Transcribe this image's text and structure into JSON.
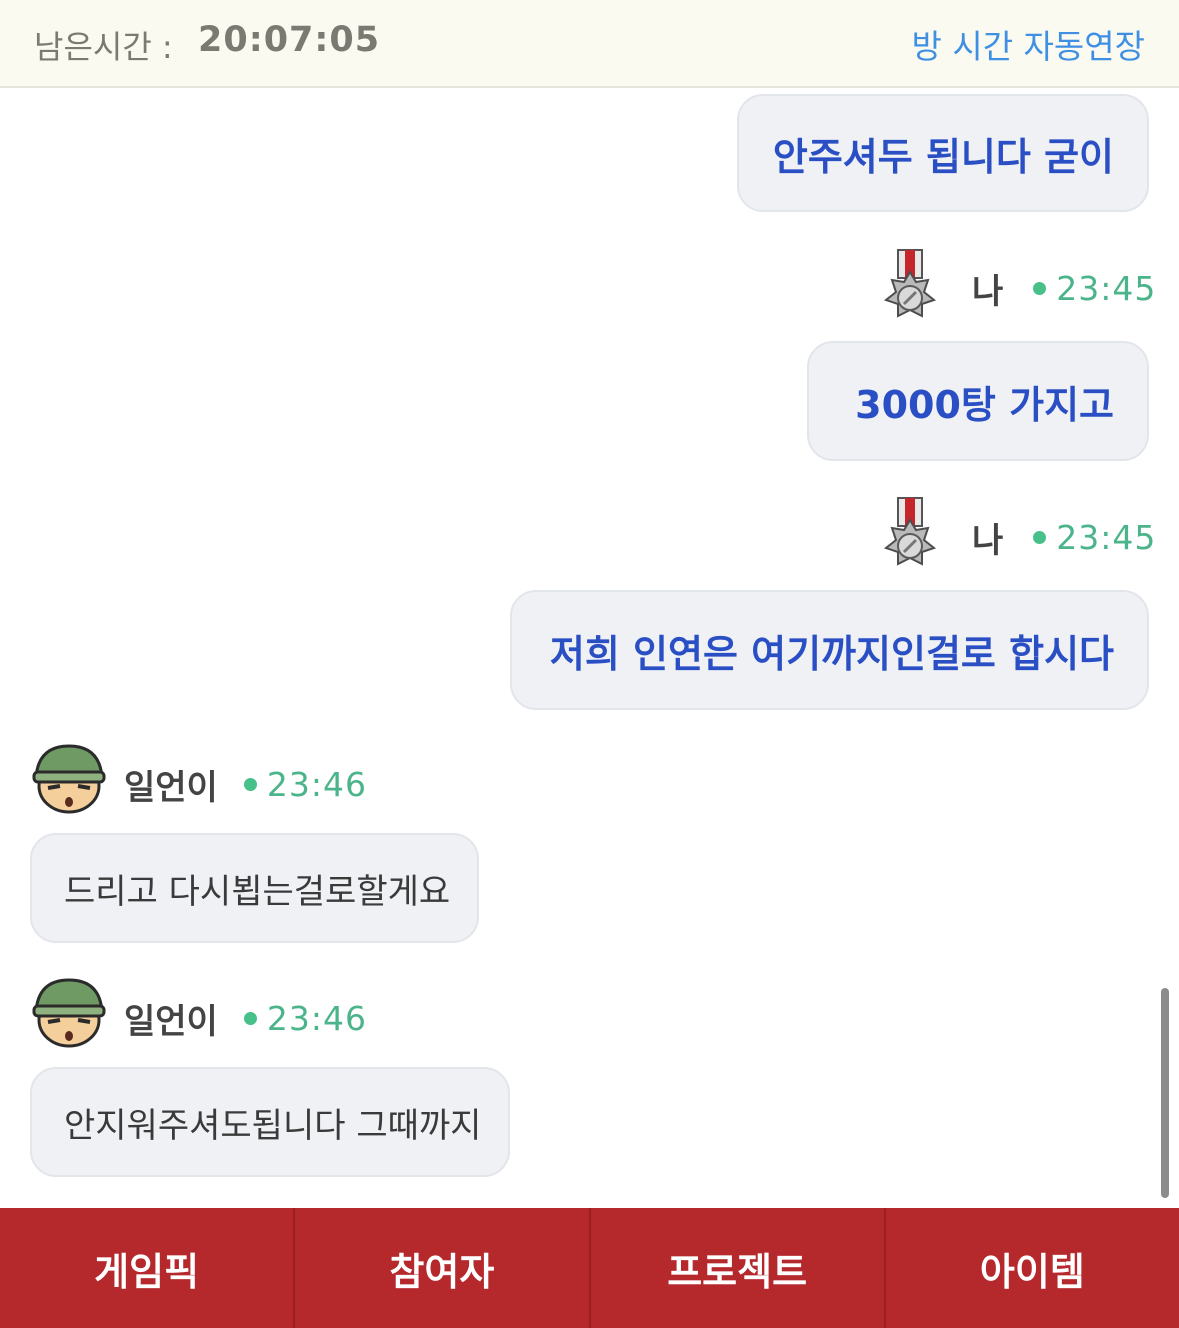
{
  "header": {
    "timer_label": "남은시간 :",
    "timer_value": "20:07:05",
    "extend_button": "방 시간 자동연장"
  },
  "messages": [
    {
      "text": "안주셔두 됩니다 굳이"
    },
    {
      "sender": "나",
      "time": "23:45",
      "avatar": "medal-icon",
      "text": "3000탕 가지고"
    },
    {
      "sender": "나",
      "time": "23:45",
      "avatar": "medal-icon",
      "text": "저희 인연은 여기까지인걸로 합시다"
    },
    {
      "sender": "일언이",
      "time": "23:46",
      "avatar": "soldier-avatar",
      "text": "드리고 다시뵙는걸로할게요"
    },
    {
      "sender": "일언이",
      "time": "23:46",
      "avatar": "soldier-avatar",
      "text": "안지워주셔도됩니다 그때까지"
    }
  ],
  "bottom_nav": {
    "tabs": [
      "게임픽",
      "참여자",
      "프로젝트",
      "아이템"
    ]
  },
  "colors": {
    "accent_red": "#b5282c",
    "my_message_text": "#2a4fc4",
    "time_green": "#4cb48a",
    "link_blue": "#3f8fe3"
  }
}
